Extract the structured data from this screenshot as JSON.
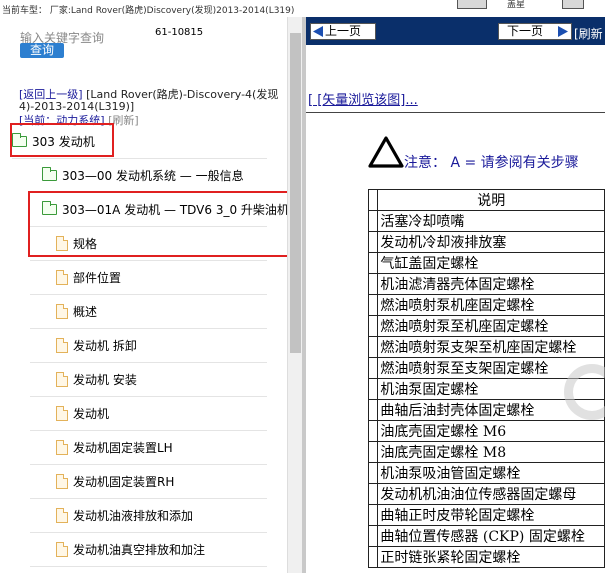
{
  "topbar": {
    "vehicle_text": "当前车型：  厂家:Land Rover(路虎)Discovery(发现)2013-2014(L319)",
    "partial_label": "盖星"
  },
  "search": {
    "placeholder": "输入关键字查询",
    "button_label": "查询",
    "result_count": "61-10815"
  },
  "nav": {
    "back_link": "[返回上一级]",
    "back_path": "[Land Rover(路虎)-Discovery-4(发现4)-2013-2014(L319)]",
    "current_label": "[当前：动力系统]",
    "refresh_label": "[刷新]"
  },
  "tree": [
    {
      "label": "303 发动机",
      "type": "folder",
      "level": 0,
      "highlighted": true
    },
    {
      "label": "303—00 发动机系统 — 一般信息",
      "type": "folder",
      "level": 1
    },
    {
      "label": "303—01A 发动机 — TDV6 3_0 升柴油机",
      "type": "folder",
      "level": 1,
      "highlighted": true
    },
    {
      "label": "规格",
      "type": "doc",
      "level": 2,
      "highlighted": true
    },
    {
      "label": "部件位置",
      "type": "doc",
      "level": 2
    },
    {
      "label": "概述",
      "type": "doc",
      "level": 2
    },
    {
      "label": "发动机 拆卸",
      "type": "doc",
      "level": 2
    },
    {
      "label": "发动机 安装",
      "type": "doc",
      "level": 2
    },
    {
      "label": "发动机",
      "type": "doc",
      "level": 2
    },
    {
      "label": "发动机固定装置LH",
      "type": "doc",
      "level": 2
    },
    {
      "label": "发动机固定装置RH",
      "type": "doc",
      "level": 2
    },
    {
      "label": "发动机油液排放和添加",
      "type": "doc",
      "level": 2
    },
    {
      "label": "发动机油真空排放和加注",
      "type": "doc",
      "level": 2
    }
  ],
  "viewer": {
    "prev_label": "上一页",
    "next_label": "下一页",
    "refresh_label": "[刷新",
    "vector_link": "[ [矢量浏览该图]...",
    "note_label": "注意：",
    "note_text": "A = 请参阅有关步骤",
    "table_header": "说明",
    "table_rows": [
      "活塞冷却喷嘴",
      "发动机冷却液排放塞",
      "气缸盖固定螺栓",
      "机油滤清器壳体固定螺栓",
      "燃油喷射泵机座固定螺栓",
      "燃油喷射泵至机座固定螺栓",
      "燃油喷射泵支架至机座固定螺栓",
      "燃油喷射泵至支架固定螺栓",
      "机油泵固定螺栓",
      "曲轴后油封壳体固定螺栓",
      "油底壳固定螺栓 M6",
      "油底壳固定螺栓 M8",
      "机油泵吸油管固定螺栓",
      "发动机机油油位传感器固定螺母",
      "曲轴正时皮带轮固定螺栓",
      "曲轴位置传感器 (CKP) 固定螺栓",
      "正时链张紧轮固定螺栓"
    ]
  },
  "colors": {
    "nav_bg": "#0a2f6a",
    "search_button": "#2d7fd0",
    "highlight": "#e02020",
    "link": "#1a1a9a"
  }
}
